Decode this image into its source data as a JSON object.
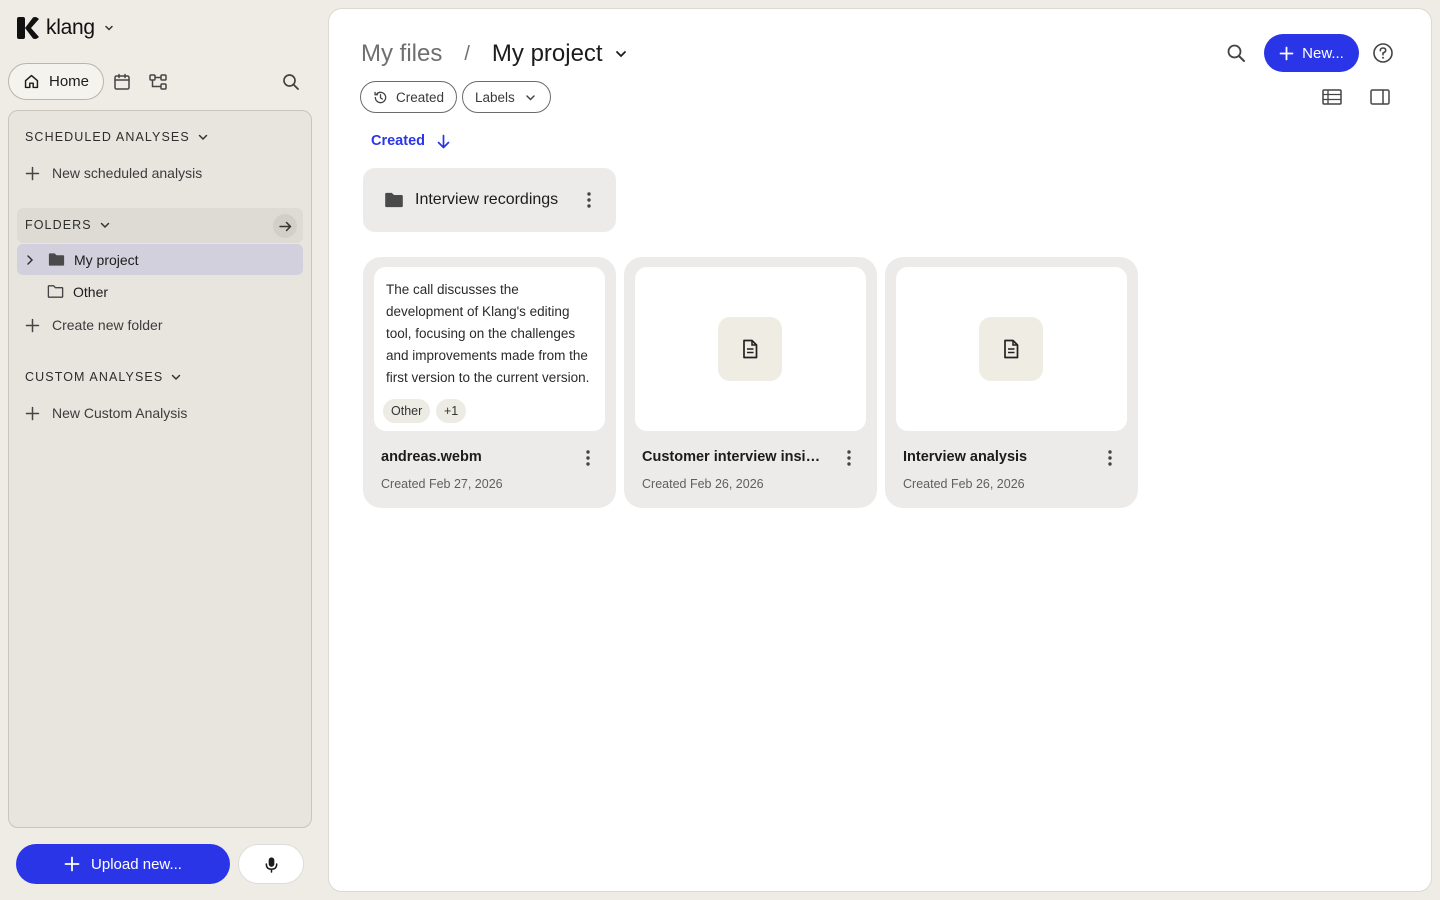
{
  "app": {
    "name": "klang"
  },
  "sidebar": {
    "home_label": "Home",
    "scheduled": {
      "heading": "SCHEDULED ANALYSES",
      "add_label": "New scheduled analysis"
    },
    "folders": {
      "heading": "FOLDERS",
      "items": [
        {
          "label": "My project",
          "selected": true,
          "icon": "folder-filled-icon"
        },
        {
          "label": "Other",
          "selected": false,
          "icon": "folder-outline-icon"
        }
      ],
      "add_label": "Create new folder"
    },
    "custom": {
      "heading": "CUSTOM ANALYSES",
      "add_label": "New Custom Analysis"
    },
    "upload_label": "Upload new..."
  },
  "main": {
    "breadcrumb": {
      "root": "My files",
      "separator": "/",
      "current": "My project"
    },
    "new_button_label": "New...",
    "filters": {
      "created_label": "Created",
      "labels_label": "Labels"
    },
    "sort": {
      "label": "Created",
      "direction": "descending"
    },
    "folders": [
      {
        "name": "Interview recordings"
      }
    ],
    "files": [
      {
        "title": "andreas.webm",
        "date": "Created Feb 27, 2026",
        "preview": "The call discusses the development of Klang's editing tool, focusing on the challenges and improvements made from the first version to the current version.",
        "tags": [
          "Other",
          "+1"
        ]
      },
      {
        "title": "Customer interview insights",
        "date": "Created Feb 26, 2026",
        "icon": "document-icon"
      },
      {
        "title": "Interview analysis",
        "date": "Created Feb 26, 2026",
        "icon": "document-icon"
      }
    ]
  },
  "colors": {
    "accent": "#2b35e8",
    "sidebar_bg": "#efece6",
    "selected_folder": "#d1d0dc"
  }
}
